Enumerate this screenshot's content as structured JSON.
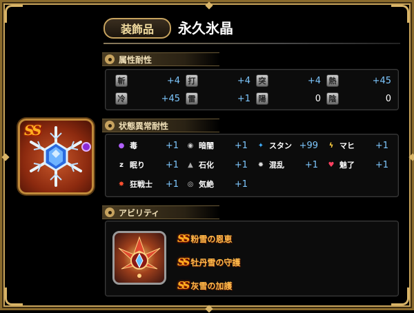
{
  "header": {
    "category_label": "装飾品",
    "item_name": "永久氷晶",
    "rank_badge": "SS"
  },
  "sections": {
    "element_resist": "属性耐性",
    "status_resist": "状態異常耐性",
    "ability": "アビリティ"
  },
  "element_resist": [
    {
      "label": "斬",
      "value": "+4",
      "zero": false
    },
    {
      "label": "打",
      "value": "+4",
      "zero": false
    },
    {
      "label": "突",
      "value": "+4",
      "zero": false
    },
    {
      "label": "熱",
      "value": "+45",
      "zero": false
    },
    {
      "label": "冷",
      "value": "+45",
      "zero": false
    },
    {
      "label": "雷",
      "value": "+1",
      "zero": false
    },
    {
      "label": "陽",
      "value": "0",
      "zero": true
    },
    {
      "label": "陰",
      "value": "0",
      "zero": true
    }
  ],
  "status_resist": [
    {
      "label": "毒",
      "value": "+1",
      "icon": "poison-icon"
    },
    {
      "label": "暗闇",
      "value": "+1",
      "icon": "darkness-icon"
    },
    {
      "label": "スタン",
      "value": "+99",
      "icon": "stun-icon"
    },
    {
      "label": "マヒ",
      "value": "+1",
      "icon": "paralysis-icon"
    },
    {
      "label": "眠り",
      "value": "+1",
      "icon": "sleep-icon"
    },
    {
      "label": "石化",
      "value": "+1",
      "icon": "petrify-icon"
    },
    {
      "label": "混乱",
      "value": "+1",
      "icon": "confusion-icon"
    },
    {
      "label": "魅了",
      "value": "+1",
      "icon": "charm-icon"
    },
    {
      "label": "狂戦士",
      "value": "+1",
      "icon": "berserk-icon"
    },
    {
      "label": "気絶",
      "value": "+1",
      "icon": "faint-icon"
    }
  ],
  "abilities": [
    {
      "badge": "SS",
      "name": "粉雪の恩恵"
    },
    {
      "badge": "SS",
      "name": "牡丹雪の守護"
    },
    {
      "badge": "SS",
      "name": "灰雪の加護"
    }
  ],
  "colors": {
    "gold_border": "#c7a35f",
    "value_blue": "#7ec8ff",
    "ability_orange": "#ffb94a"
  }
}
